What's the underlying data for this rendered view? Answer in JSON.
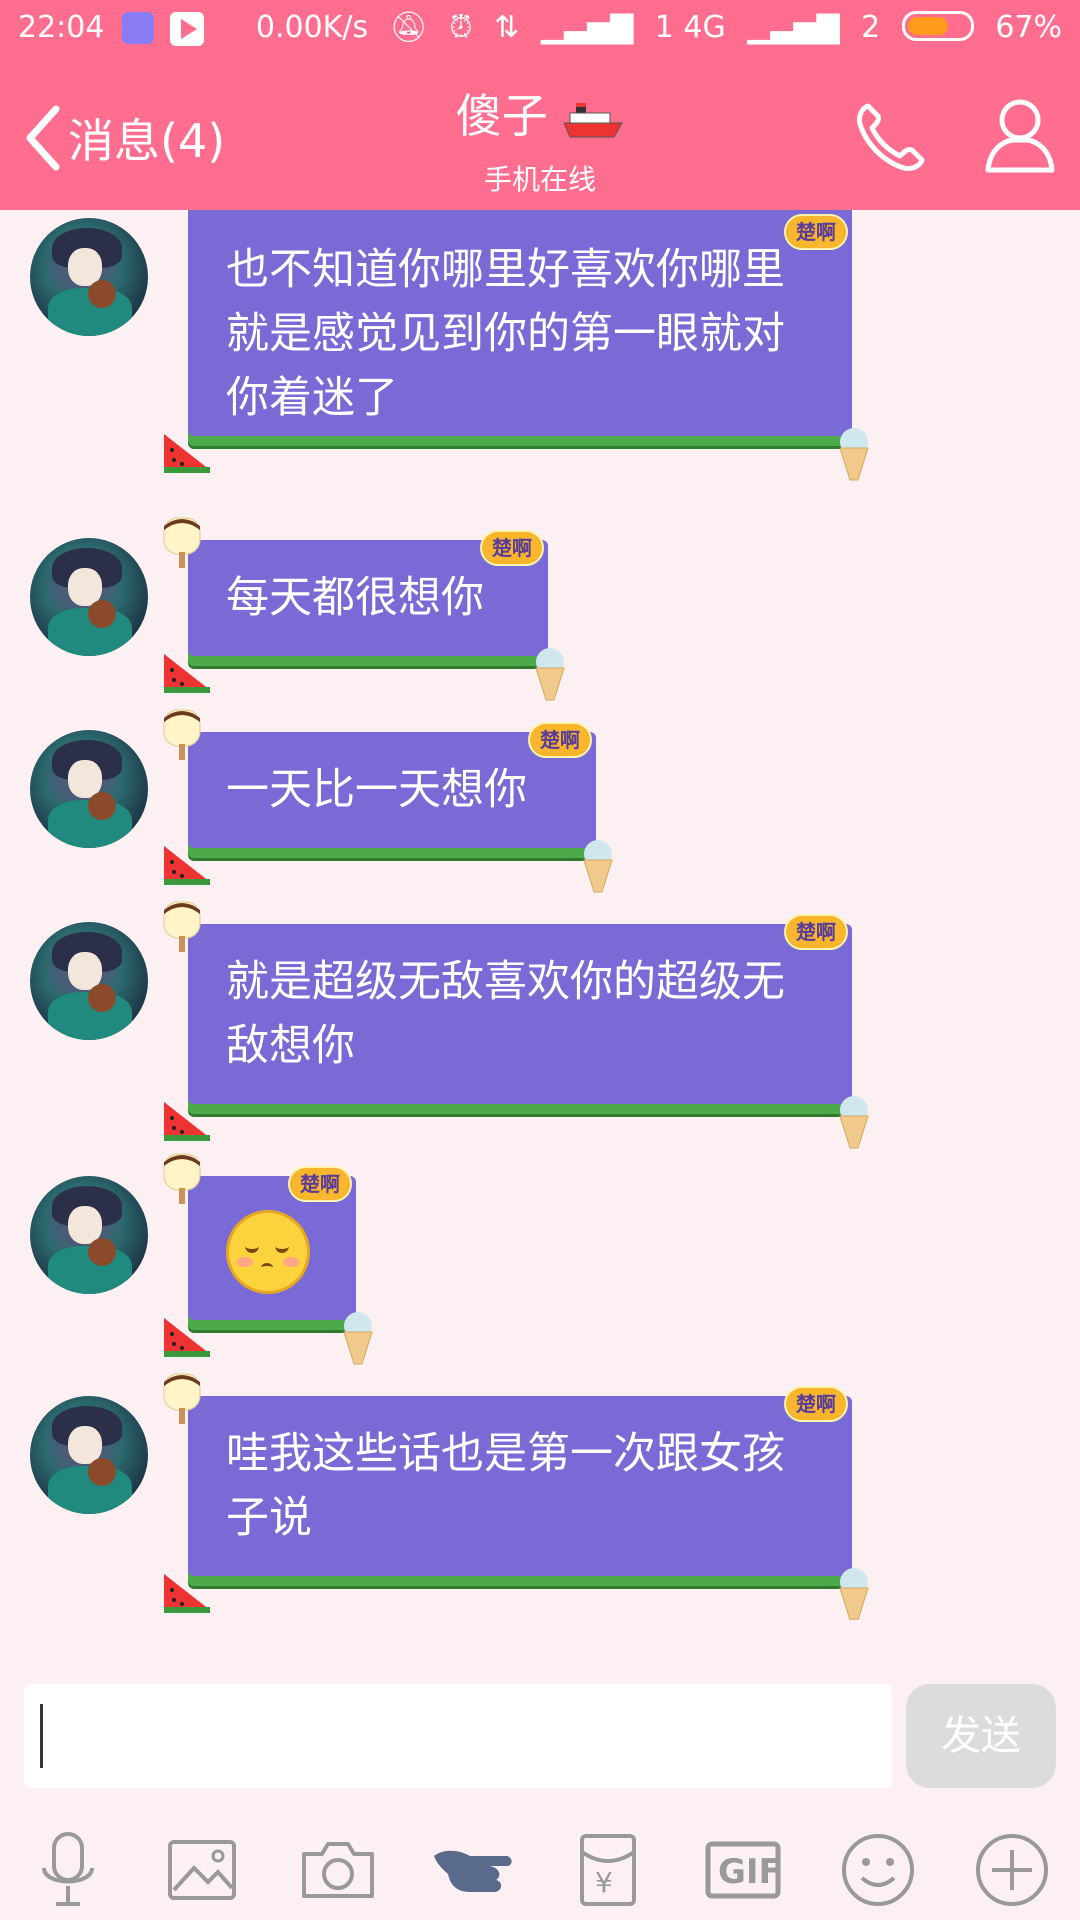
{
  "status_bar": {
    "time": "22:04",
    "network_speed": "0.00K/s",
    "sim1_label": "1 4G",
    "sim2_label": "2",
    "battery_percent": "67%",
    "battery_level": 0.67
  },
  "header": {
    "back_label": "消息(4)",
    "contact_name": "傻子",
    "contact_status": "手机在线"
  },
  "messages": [
    {
      "text": "也不知道你哪里好喜欢你哪里就是感觉见到你的第一眼就对你着迷了",
      "tag": "楚啊"
    },
    {
      "text": "每天都很想你",
      "tag": "楚啊"
    },
    {
      "text": "一天比一天想你",
      "tag": "楚啊"
    },
    {
      "text": "就是超级无敌喜欢你的超级无敌想你",
      "tag": "楚啊"
    },
    {
      "text": "",
      "tag": "楚啊",
      "emoji": "blushing-smile-emoji"
    },
    {
      "text": "哇我这些话也是第一次跟女孩子说",
      "tag": "楚啊"
    }
  ],
  "input": {
    "value": "",
    "send_label": "发送"
  },
  "toolbar": {
    "icons": [
      "microphone-icon",
      "image-icon",
      "camera-icon",
      "poke-hand-icon",
      "red-packet-icon",
      "gif-icon",
      "emoji-icon",
      "plus-icon"
    ],
    "gif_label": "GIF",
    "red_packet_symbol": "¥"
  },
  "colors": {
    "header": "#ff6e8f",
    "bubble": "#7a6ad6",
    "bubble_border": "#4caa4a",
    "background": "#fdf0f3"
  }
}
